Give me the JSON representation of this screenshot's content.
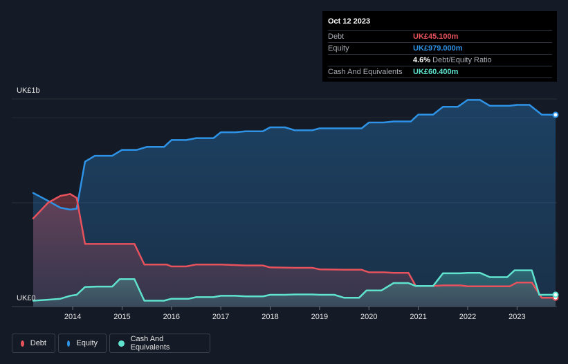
{
  "tooltip": {
    "date": "Oct 12 2023",
    "debt_label": "Debt",
    "debt_value": "UK£45.100m",
    "equity_label": "Equity",
    "equity_value": "UK£979.000m",
    "ratio_pct": "4.6%",
    "ratio_label": "Debt/Equity Ratio",
    "cash_label": "Cash And Equivalents",
    "cash_value": "UK£60.400m"
  },
  "legend": {
    "debt": "Debt",
    "equity": "Equity",
    "cash": "Cash And Equivalents"
  },
  "colors": {
    "debt": "#e8525d",
    "equity": "#2e93e6",
    "cash": "#5fe3cf",
    "background": "#151b26"
  },
  "chart_data": {
    "type": "area",
    "title": "",
    "xlabel": "",
    "ylabel": "",
    "y_top_label": "UK£1b",
    "y_bottom_label": "UK£0",
    "ylim": [
      0,
      1060
    ],
    "xlim": [
      2013.2,
      2023.78
    ],
    "x_ticks": [
      "2014",
      "2015",
      "2016",
      "2017",
      "2018",
      "2019",
      "2020",
      "2021",
      "2022",
      "2023"
    ],
    "series": [
      {
        "name": "Equity",
        "points": [
          [
            2013.2,
            580
          ],
          [
            2013.5,
            540
          ],
          [
            2013.75,
            505
          ],
          [
            2013.95,
            495
          ],
          [
            2014.08,
            500
          ],
          [
            2014.25,
            740
          ],
          [
            2014.45,
            770
          ],
          [
            2014.8,
            770
          ],
          [
            2015.0,
            800
          ],
          [
            2015.3,
            800
          ],
          [
            2015.5,
            815
          ],
          [
            2015.85,
            815
          ],
          [
            2016.0,
            850
          ],
          [
            2016.3,
            850
          ],
          [
            2016.5,
            860
          ],
          [
            2016.85,
            860
          ],
          [
            2017.0,
            890
          ],
          [
            2017.3,
            890
          ],
          [
            2017.5,
            895
          ],
          [
            2017.85,
            895
          ],
          [
            2018.0,
            915
          ],
          [
            2018.3,
            915
          ],
          [
            2018.5,
            900
          ],
          [
            2018.85,
            900
          ],
          [
            2019.0,
            910
          ],
          [
            2019.3,
            910
          ],
          [
            2019.5,
            910
          ],
          [
            2019.85,
            910
          ],
          [
            2020.0,
            940
          ],
          [
            2020.3,
            940
          ],
          [
            2020.5,
            945
          ],
          [
            2020.85,
            945
          ],
          [
            2021.0,
            980
          ],
          [
            2021.3,
            980
          ],
          [
            2021.5,
            1020
          ],
          [
            2021.8,
            1020
          ],
          [
            2022.0,
            1055
          ],
          [
            2022.25,
            1055
          ],
          [
            2022.45,
            1025
          ],
          [
            2022.85,
            1025
          ],
          [
            2023.0,
            1030
          ],
          [
            2023.25,
            1030
          ],
          [
            2023.5,
            980
          ],
          [
            2023.78,
            979
          ]
        ]
      },
      {
        "name": "Debt",
        "points": [
          [
            2013.2,
            450
          ],
          [
            2013.5,
            530
          ],
          [
            2013.75,
            565
          ],
          [
            2013.95,
            575
          ],
          [
            2014.08,
            555
          ],
          [
            2014.25,
            320
          ],
          [
            2014.5,
            320
          ],
          [
            2015.0,
            320
          ],
          [
            2015.25,
            320
          ],
          [
            2015.45,
            215
          ],
          [
            2015.9,
            215
          ],
          [
            2016.0,
            205
          ],
          [
            2016.3,
            205
          ],
          [
            2016.5,
            215
          ],
          [
            2017.0,
            215
          ],
          [
            2017.5,
            210
          ],
          [
            2017.85,
            210
          ],
          [
            2018.0,
            200
          ],
          [
            2018.5,
            198
          ],
          [
            2018.85,
            198
          ],
          [
            2019.0,
            190
          ],
          [
            2019.5,
            188
          ],
          [
            2019.85,
            188
          ],
          [
            2020.0,
            175
          ],
          [
            2020.3,
            175
          ],
          [
            2020.5,
            172
          ],
          [
            2020.8,
            172
          ],
          [
            2020.95,
            105
          ],
          [
            2021.3,
            105
          ],
          [
            2021.5,
            108
          ],
          [
            2021.85,
            108
          ],
          [
            2022.0,
            103
          ],
          [
            2022.5,
            103
          ],
          [
            2022.85,
            103
          ],
          [
            2023.0,
            123
          ],
          [
            2023.3,
            123
          ],
          [
            2023.5,
            45
          ],
          [
            2023.78,
            45.1
          ]
        ]
      },
      {
        "name": "Cash And Equivalents",
        "points": [
          [
            2013.2,
            30
          ],
          [
            2013.5,
            35
          ],
          [
            2013.75,
            40
          ],
          [
            2013.95,
            55
          ],
          [
            2014.08,
            60
          ],
          [
            2014.25,
            100
          ],
          [
            2014.5,
            102
          ],
          [
            2014.8,
            102
          ],
          [
            2014.95,
            140
          ],
          [
            2015.25,
            140
          ],
          [
            2015.45,
            30
          ],
          [
            2015.85,
            30
          ],
          [
            2016.0,
            40
          ],
          [
            2016.35,
            40
          ],
          [
            2016.5,
            48
          ],
          [
            2016.85,
            48
          ],
          [
            2017.0,
            55
          ],
          [
            2017.3,
            55
          ],
          [
            2017.5,
            52
          ],
          [
            2017.85,
            52
          ],
          [
            2018.0,
            60
          ],
          [
            2018.3,
            60
          ],
          [
            2018.5,
            62
          ],
          [
            2018.85,
            62
          ],
          [
            2019.0,
            60
          ],
          [
            2019.3,
            60
          ],
          [
            2019.5,
            45
          ],
          [
            2019.8,
            45
          ],
          [
            2019.95,
            82
          ],
          [
            2020.25,
            82
          ],
          [
            2020.5,
            120
          ],
          [
            2020.8,
            120
          ],
          [
            2020.95,
            105
          ],
          [
            2021.3,
            105
          ],
          [
            2021.5,
            170
          ],
          [
            2021.85,
            170
          ],
          [
            2022.0,
            172
          ],
          [
            2022.25,
            172
          ],
          [
            2022.45,
            150
          ],
          [
            2022.8,
            150
          ],
          [
            2022.95,
            185
          ],
          [
            2023.3,
            185
          ],
          [
            2023.45,
            60
          ],
          [
            2023.78,
            60.4
          ]
        ]
      }
    ]
  }
}
